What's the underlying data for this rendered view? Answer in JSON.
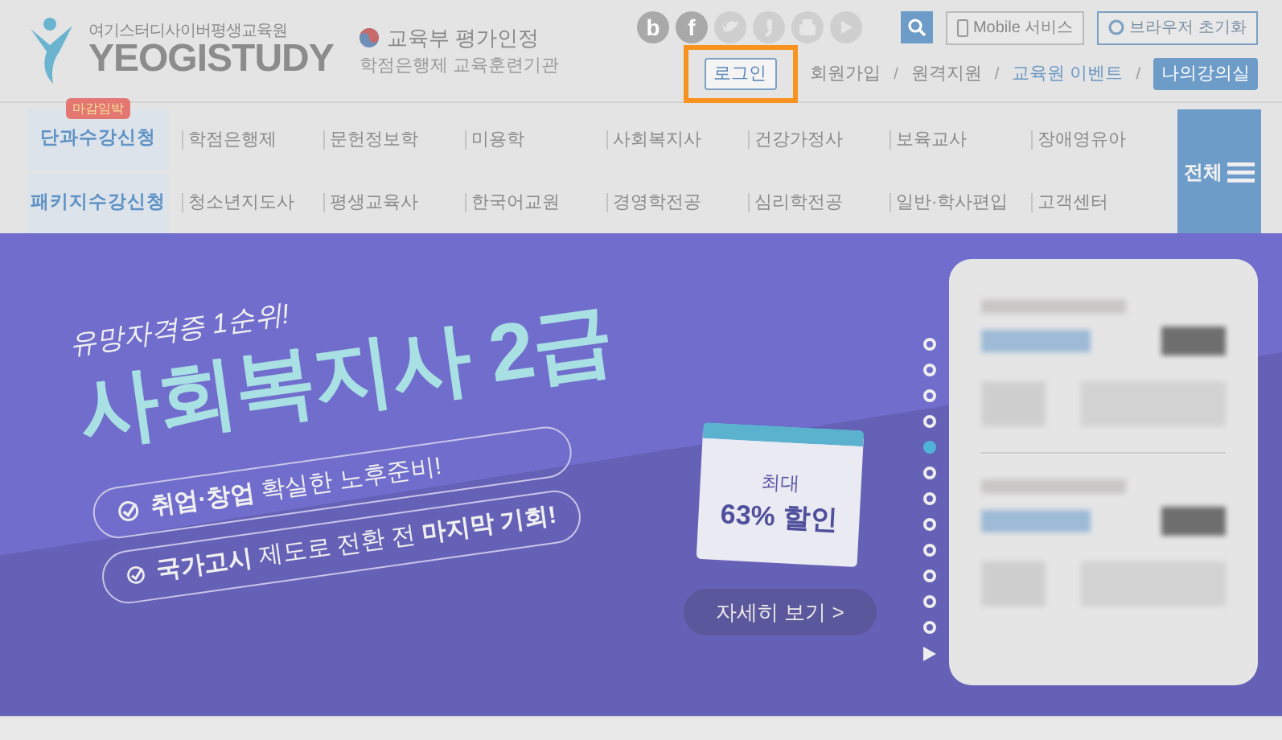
{
  "header": {
    "logo": {
      "korean_name": "여기스터디사이버평생교육원",
      "brand": "YEOGISTUDY"
    },
    "certification": {
      "title": "교육부 평가인정",
      "subtitle": "학점은행제 교육훈련기관"
    },
    "social_icons": [
      {
        "kind": "letter",
        "glyph": "b"
      },
      {
        "kind": "letter",
        "glyph": "f"
      },
      {
        "kind": "bird"
      },
      {
        "kind": "quote"
      },
      {
        "kind": "tube"
      },
      {
        "kind": "play"
      }
    ],
    "mobile_button": "Mobile 서비스",
    "reset_button": "브라우저 초기화",
    "user_links": [
      {
        "kind": "outlined",
        "label": "로그인",
        "highlighted": true
      },
      {
        "kind": "plain",
        "label": "회원가입"
      },
      {
        "kind": "separator",
        "label": "/"
      },
      {
        "kind": "plain",
        "label": "원격지원"
      },
      {
        "kind": "separator",
        "label": "/"
      },
      {
        "kind": "accent",
        "label": "교육원 이벤트"
      },
      {
        "kind": "separator",
        "label": "/"
      },
      {
        "kind": "filled",
        "label": "나의강의실"
      }
    ]
  },
  "nav": {
    "rows": [
      {
        "lead": "단과수강신청",
        "badge": "마감임박",
        "items": [
          "학점은행제",
          "문헌정보학",
          "미용학",
          "사회복지사",
          "건강가정사",
          "보육교사",
          "장애영유아"
        ]
      },
      {
        "lead": "패키지수강신청",
        "items": [
          "청소년지도사",
          "평생교육사",
          "한국어교원",
          "경영학전공",
          "심리학전공",
          "일반·학사편입",
          "고객센터"
        ]
      }
    ],
    "all_button": "전체"
  },
  "banner": {
    "tagline": "유망자격증 1순위!",
    "title": "사회복지사 2급",
    "points": [
      "**취업·창업** 확실한 노후준비!",
      "**국가고시** 제도로 전환 전 **마지막 기회!**"
    ],
    "calendar": {
      "line1": "최대",
      "line2": "63% 할인"
    },
    "more_button": "자세히 보기 >",
    "pager": [
      {
        "selected": false
      },
      {
        "selected": false
      },
      {
        "selected": false
      },
      {
        "selected": false
      },
      {
        "selected": true
      },
      {
        "selected": false
      },
      {
        "selected": false
      },
      {
        "selected": false
      },
      {
        "selected": false
      },
      {
        "selected": false
      },
      {
        "selected": false
      },
      {
        "selected": false
      }
    ]
  }
}
